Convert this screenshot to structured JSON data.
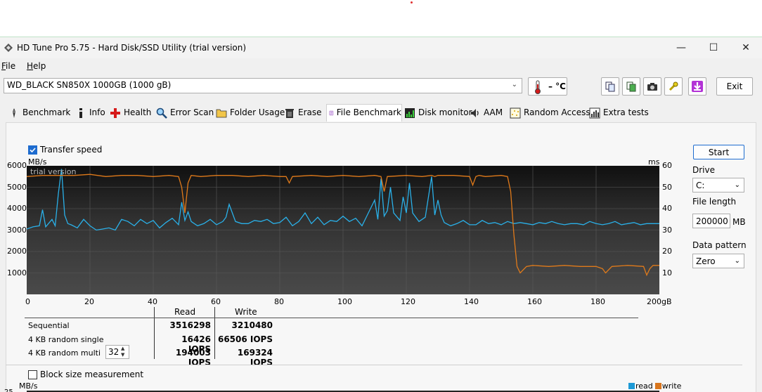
{
  "window": {
    "title": "HD Tune Pro 5.75 - Hard Disk/SSD Utility (trial version)",
    "controls": [
      "—",
      "☐",
      "✕"
    ]
  },
  "menu": [
    {
      "label": "File",
      "mnemonic": "F",
      "rest": "ile"
    },
    {
      "label": "Help",
      "mnemonic": "H",
      "rest": "elp"
    }
  ],
  "drive": {
    "selected": "WD_BLACK SN850X 1000GB (1000 gB)"
  },
  "temperature": {
    "text": "– °C"
  },
  "exit_label": "Exit",
  "tabs": [
    {
      "label": "Benchmark",
      "icon": "benchmark-icon"
    },
    {
      "label": "Info",
      "icon": "info-icon"
    },
    {
      "label": "Health",
      "icon": "health-icon"
    },
    {
      "label": "Error Scan",
      "icon": "error-scan-icon"
    },
    {
      "label": "Folder Usage",
      "icon": "folder-icon"
    },
    {
      "label": "Erase",
      "icon": "erase-icon"
    },
    {
      "label": "File Benchmark",
      "icon": "file-benchmark-icon",
      "active": true
    },
    {
      "label": "Disk monitor",
      "icon": "disk-monitor-icon"
    },
    {
      "label": "AAM",
      "icon": "aam-icon"
    },
    {
      "label": "Random Access",
      "icon": "random-access-icon"
    },
    {
      "label": "Extra tests",
      "icon": "extra-tests-icon"
    }
  ],
  "transfer_speed_label": "Transfer speed",
  "block_size_label": "Block size measurement",
  "controls_panel": {
    "start_label": "Start",
    "drive_label": "Drive",
    "drive_value": "C:",
    "file_length_label": "File length",
    "file_length_value": "200000",
    "file_length_unit": "MB",
    "data_pattern_label": "Data pattern",
    "data_pattern_value": "Zero"
  },
  "results": {
    "header_read": "Read",
    "header_write": "Write",
    "rows": [
      {
        "label": "Sequential",
        "read": "3516298",
        "write": "3210480"
      },
      {
        "label": "4 KB random single",
        "read": "16426 IOPS",
        "write": "66506 IOPS"
      },
      {
        "label": "4 KB random multi",
        "read": "194003 IOPS",
        "write": "169324 IOPS",
        "queue": "32"
      }
    ]
  },
  "legend": {
    "read": "read",
    "write": "write"
  },
  "second_chart_unit": "MB/s",
  "second_chart_top_tick": "25",
  "chart_data": {
    "type": "line",
    "watermark": "trial version",
    "y_left_unit": "MB/s",
    "y_right_unit": "ms",
    "y_left_ticks": [
      "6000",
      "5000",
      "4000",
      "3000",
      "2000",
      "1000"
    ],
    "y_right_ticks": [
      "60",
      "50",
      "40",
      "30",
      "20",
      "10"
    ],
    "x_ticks": [
      "0",
      "20",
      "40",
      "60",
      "80",
      "100",
      "120",
      "140",
      "160",
      "180",
      "200gB"
    ],
    "xlim": [
      0,
      200
    ],
    "ylim_left": [
      0,
      6000
    ],
    "ylim_right": [
      0,
      60
    ],
    "grid": true,
    "series": [
      {
        "name": "read",
        "color": "#2ab0e8",
        "axis": "left",
        "x": [
          0,
          2,
          4,
          5,
          6,
          8,
          9,
          10,
          11,
          12,
          13,
          14,
          16,
          18,
          20,
          22,
          24,
          26,
          28,
          30,
          32,
          34,
          36,
          38,
          40,
          42,
          44,
          46,
          48,
          49,
          50,
          51,
          52,
          54,
          56,
          58,
          60,
          62,
          63,
          64,
          66,
          68,
          70,
          72,
          74,
          76,
          78,
          80,
          82,
          84,
          86,
          88,
          90,
          92,
          94,
          96,
          98,
          100,
          102,
          104,
          106,
          108,
          110,
          111,
          112,
          113,
          114,
          115,
          116,
          118,
          119,
          120,
          121,
          122,
          124,
          126,
          128,
          129,
          130,
          131,
          132,
          134,
          136,
          138,
          140,
          142,
          144,
          146,
          148,
          150,
          152,
          154,
          156,
          158,
          160,
          162,
          164,
          166,
          168,
          170,
          172,
          174,
          176,
          178,
          180,
          182,
          184,
          186,
          188,
          190,
          192,
          194,
          196,
          198,
          200
        ],
        "y": [
          3050,
          3150,
          3200,
          3950,
          3150,
          3500,
          3200,
          4700,
          5850,
          3700,
          3300,
          3250,
          3100,
          3500,
          3200,
          3000,
          3050,
          3100,
          3000,
          3500,
          3400,
          3200,
          3500,
          3300,
          3450,
          3100,
          3350,
          3550,
          3250,
          4300,
          3450,
          3850,
          3400,
          3200,
          3300,
          3500,
          3250,
          3400,
          3600,
          4200,
          3400,
          3300,
          3300,
          3450,
          3400,
          3500,
          3300,
          3350,
          3600,
          3200,
          3400,
          3800,
          3300,
          3600,
          3250,
          3450,
          3400,
          3650,
          3400,
          3550,
          3200,
          3800,
          4400,
          3500,
          5400,
          3650,
          3900,
          5000,
          3800,
          3450,
          4550,
          3800,
          5200,
          3800,
          3400,
          3600,
          5500,
          3700,
          4400,
          3700,
          3350,
          3200,
          3300,
          3450,
          3250,
          3250,
          3450,
          3300,
          3350,
          3250,
          3400,
          3300,
          3350,
          3300,
          3250,
          3350,
          3300,
          3400,
          3300,
          3250,
          3300,
          3300,
          3250,
          3400,
          3300,
          3250,
          3300,
          3400,
          3250,
          3300,
          3350,
          3250,
          3300,
          3300,
          3300
        ]
      },
      {
        "name": "write",
        "color": "#e07a1a",
        "axis": "right",
        "x": [
          0,
          5,
          10,
          15,
          20,
          25,
          30,
          35,
          40,
          45,
          48,
          49,
          50,
          51,
          52,
          55,
          60,
          65,
          70,
          75,
          80,
          82,
          83,
          84,
          90,
          95,
          100,
          105,
          110,
          112,
          113,
          114,
          120,
          125,
          128,
          129,
          130,
          135,
          140,
          141,
          142,
          143,
          145,
          150,
          152,
          153,
          154,
          155,
          156,
          158,
          160,
          165,
          170,
          175,
          180,
          182,
          183,
          185,
          190,
          195,
          196,
          197,
          198,
          200
        ],
        "y": [
          55,
          55.5,
          55.5,
          55.5,
          56,
          55,
          55.5,
          55.5,
          55,
          55.5,
          55,
          50,
          38,
          52,
          55.5,
          55,
          55.5,
          55.5,
          55,
          55.5,
          55,
          55,
          52,
          55,
          55.5,
          55,
          55.5,
          55,
          55.5,
          55,
          48,
          55,
          55.5,
          55,
          55.5,
          55,
          55.5,
          55.5,
          55,
          51,
          55,
          55.5,
          55,
          55.5,
          55,
          48,
          28,
          13,
          10,
          13,
          13.5,
          13,
          13.5,
          13,
          13,
          12,
          10,
          13,
          13.5,
          13,
          9,
          12,
          13.5,
          13.5
        ]
      }
    ]
  }
}
